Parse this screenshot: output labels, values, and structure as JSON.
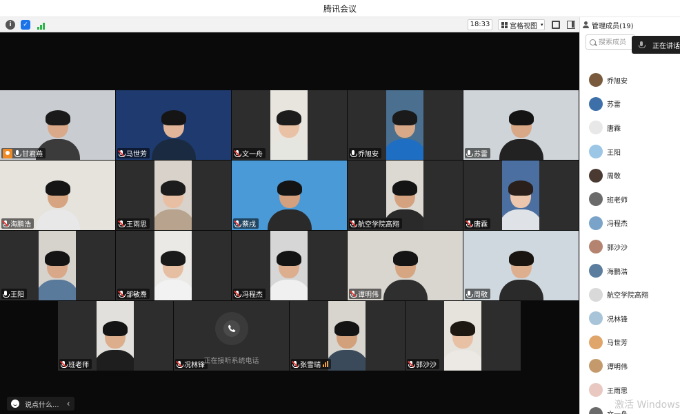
{
  "app": {
    "title": "腾讯会议"
  },
  "toolbar": {
    "icons": [
      "info-icon",
      "shield-icon",
      "signal-icon"
    ],
    "time": "18:33",
    "view_mode": "宫格视图"
  },
  "sidebar": {
    "header": "管理成员(19)",
    "search_placeholder": "搜索成员",
    "speaking_label": "正在讲话:",
    "members": [
      {
        "name": "乔旭安",
        "avatar_color": "#7a5a3c"
      },
      {
        "name": "苏雷",
        "avatar_color": "#3d6fa8"
      },
      {
        "name": "唐霖",
        "avatar_color": "#e8e8e8"
      },
      {
        "name": "王阳",
        "avatar_color": "#9cc6e6"
      },
      {
        "name": "周敬",
        "avatar_color": "#4a3a32"
      },
      {
        "name": "班老师",
        "avatar_color": "#6b6b6b"
      },
      {
        "name": "冯程杰",
        "avatar_color": "#7aa3c9"
      },
      {
        "name": "郭沙沙",
        "avatar_color": "#b58470"
      },
      {
        "name": "海鹏浩",
        "avatar_color": "#5b7d9e"
      },
      {
        "name": "航空学院高翔",
        "avatar_color": "#d9d9d9"
      },
      {
        "name": "况林锋",
        "avatar_color": "#a8c4d8"
      },
      {
        "name": "马世芳",
        "avatar_color": "#e0a56a"
      },
      {
        "name": "谭明伟",
        "avatar_color": "#c49a6c"
      },
      {
        "name": "王雨思",
        "avatar_color": "#e8c8c0"
      },
      {
        "name": "文一舟",
        "avatar_color": "#6a6a6a"
      }
    ]
  },
  "video": {
    "tiles": [
      {
        "name": "甘君燕",
        "mic": "on",
        "host": true,
        "bg": "#c9cdd1",
        "skin": "#d9a98a",
        "shirt": "#3b3b3b",
        "hair": "#1a1a1a"
      },
      {
        "name": "马世芳",
        "mic": "off",
        "bg": "#1e3a6e",
        "skin": "#e0b59a",
        "shirt": "#1a2a40",
        "hair": "#151515"
      },
      {
        "name": "文一舟",
        "mic": "off",
        "bg": "#e8e4de",
        "skin": "#e9c2a6",
        "shirt": "#e6e6e0",
        "hair": "#1c1c1c"
      },
      {
        "name": "乔旭安",
        "mic": "on",
        "bg": "#4a6f8f",
        "skin": "#d7a989",
        "shirt": "#1e6fc4",
        "hair": "#1a1a1a"
      },
      {
        "name": "苏雷",
        "mic": "on",
        "bg": "#cfd4d8",
        "skin": "#d9a886",
        "shirt": "#222",
        "hair": "#141414"
      },
      {
        "name": "海鹏浩",
        "mic": "off",
        "bg": "#e6e2dc",
        "skin": "#d6a480",
        "shirt": "#e8e8e8",
        "hair": "#151515"
      },
      {
        "name": "王雨思",
        "mic": "off",
        "bg": "#d8d2ca",
        "skin": "#e8bfa3",
        "shirt": "#b8a48e",
        "hair": "#1c1c1c"
      },
      {
        "name": "蔡戌",
        "mic": "off",
        "bg": "#4a9ad8",
        "skin": "#d4a07e",
        "shirt": "#2a2a2a",
        "hair": "#141414"
      },
      {
        "name": "航空学院高翔",
        "mic": "off",
        "bg": "#dcd8d2",
        "skin": "#d4a27e",
        "shirt": "#2a2a2a",
        "hair": "#141414"
      },
      {
        "name": "唐霖",
        "mic": "off",
        "bg": "#4a6fa0",
        "skin": "#ecc7ad",
        "shirt": "#dfe2e6",
        "hair": "#2a1f1a"
      },
      {
        "name": "王阳",
        "mic": "on",
        "bg": "#d6d2cc",
        "skin": "#d8a888",
        "shirt": "#5a7a9c",
        "hair": "#141414"
      },
      {
        "name": "邹敏焘",
        "mic": "off",
        "bg": "#ebe9e6",
        "skin": "#e6bea2",
        "shirt": "#f2f2f2",
        "hair": "#1a1a1a"
      },
      {
        "name": "冯程杰",
        "mic": "off",
        "bg": "#d6d6d6",
        "skin": "#dcae8e",
        "shirt": "#f0f0f0",
        "hair": "#141414"
      },
      {
        "name": "谭明伟",
        "mic": "off",
        "bg": "#d9d6d0",
        "skin": "#d6a682",
        "shirt": "#2f2f2f",
        "hair": "#141414"
      },
      {
        "name": "周敬",
        "mic": "on",
        "bg": "#cfd8de",
        "skin": "#ddaf8f",
        "shirt": "#2a2a2a",
        "hair": "#1a1410"
      },
      {
        "name": "班老师",
        "mic": "off",
        "bg": "#e2e0dc",
        "skin": "#dcae8c",
        "shirt": "#1e1e1e",
        "hair": "#141414"
      },
      {
        "name": "况林锋",
        "mic": "off",
        "call": true,
        "call_text": "正在接听系统电话"
      },
      {
        "name": "张雪瑞",
        "mic": "off",
        "speaking": true,
        "bg": "#d8d4ce",
        "skin": "#d3a07c",
        "shirt": "#3a4a5a",
        "hair": "#141414"
      },
      {
        "name": "郭沙沙",
        "mic": "off",
        "bg": "#e6e2dc",
        "skin": "#e8c0a4",
        "shirt": "#ece9e4",
        "hair": "#1e1812"
      }
    ]
  },
  "chat": {
    "placeholder": "说点什么..."
  },
  "overlay": {
    "watermark": "激活 Windows"
  },
  "colors": {
    "accent": "#1a73e8",
    "host_badge": "#f08a24",
    "mic_muted": "#e53935",
    "speaking_bars": "#f2a13a",
    "signal": "#2cb34a"
  }
}
